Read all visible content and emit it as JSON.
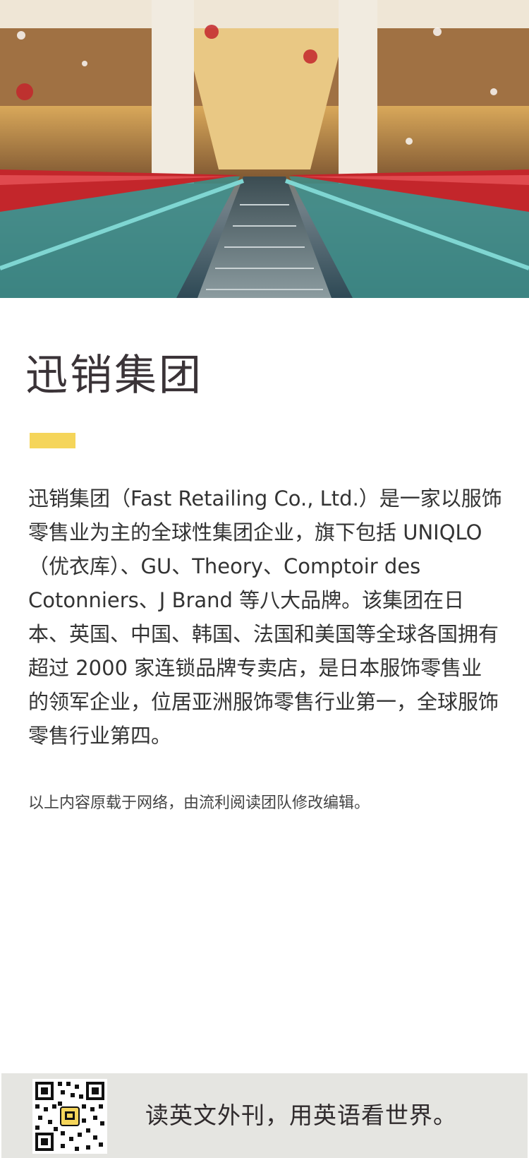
{
  "hero": {
    "image": "shopping-mall-escalator-photo",
    "colors": {
      "escalator_rail": "#c3262b",
      "glass": "#4fa7a3"
    }
  },
  "article": {
    "title": "迅销集团",
    "accent_color": "#f5d55a",
    "body": "迅销集团（Fast Retailing Co., Ltd.）是一家以服饰零售业为主的全球性集团企业，旗下包括 UNIQLO（优衣库）、GU、Theory、Comptoir des Cotonniers、J Brand 等八大品牌。该集团在日本、英国、中国、韩国、法国和美国等全球各国拥有超过 2000 家连锁品牌专卖店，是日本服饰零售业的领军企业，位居亚洲服饰零售行业第一，全球服饰零售行业第四。",
    "source_note": "以上内容原载于网络，由流利阅读团队修改编辑。"
  },
  "footer": {
    "qr_icon": "qr-code-icon",
    "slogan": "读英文外刊，用英语看世界。",
    "background": "#e5e5e1"
  }
}
